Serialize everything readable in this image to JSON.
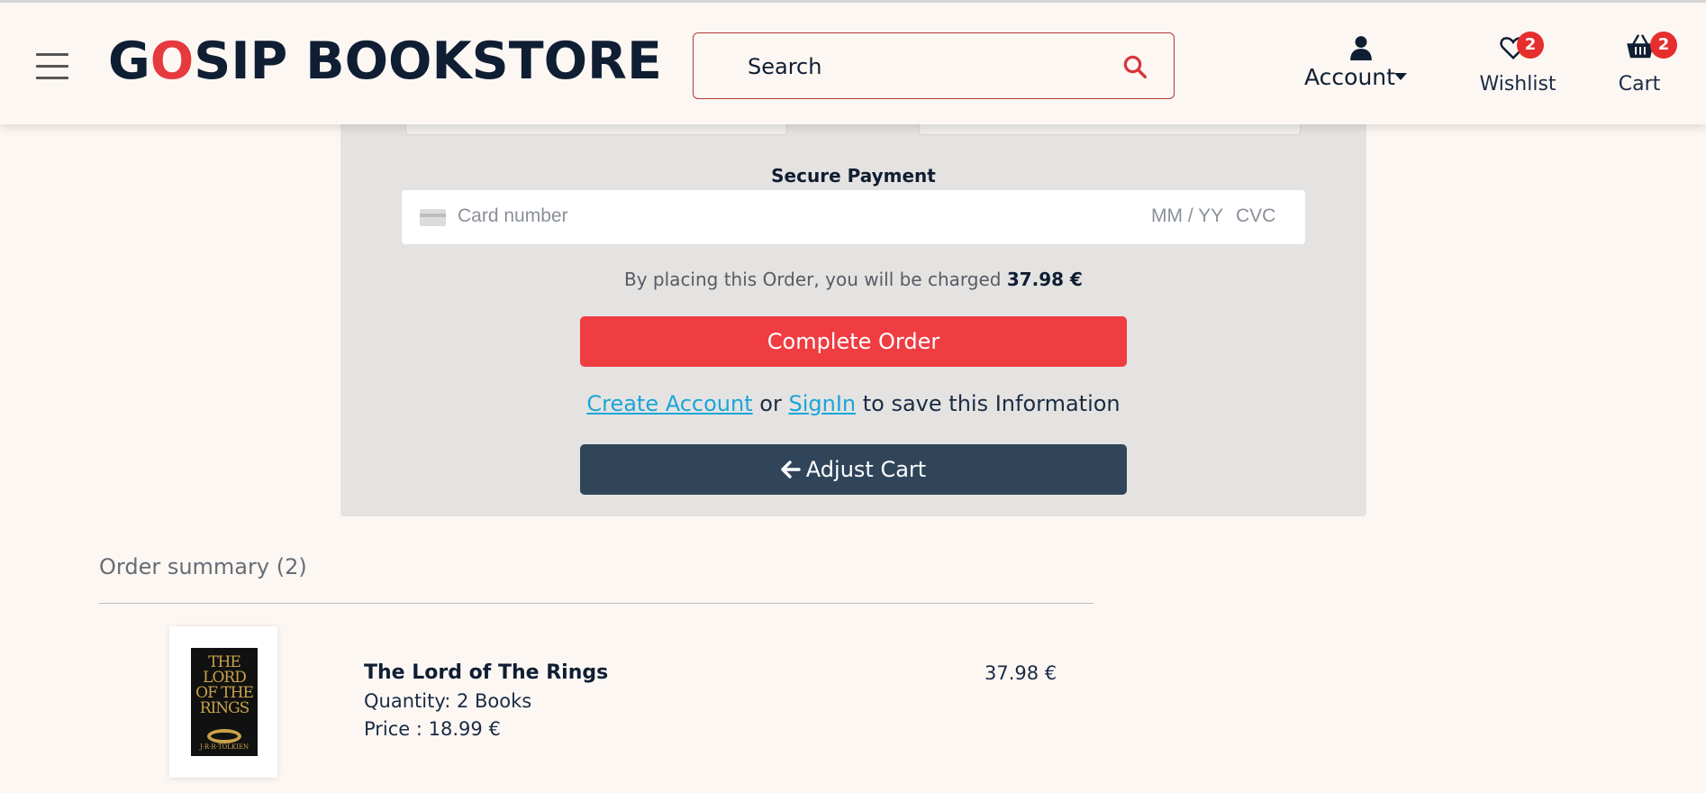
{
  "header": {
    "logo_g": "G",
    "logo_o": "O",
    "logo_rest": "SIP BOOKSTORE",
    "search_placeholder": "Search",
    "account_label": "Account",
    "wishlist_label": "Wishlist",
    "wishlist_count": "2",
    "cart_label": "Cart",
    "cart_count": "2"
  },
  "payment": {
    "section_title": "Secure Payment",
    "card_placeholder": "Card number",
    "expiry_placeholder": "MM / YY",
    "cvc_placeholder": "CVC",
    "charge_text": "By placing this Order, you will be charged",
    "charge_amount": "37.98 €",
    "complete_button": "Complete Order",
    "create_account_link": "Create Account",
    "or_text": "or",
    "signin_link": "SignIn",
    "save_text": "to save this Information",
    "adjust_button": "Adjust Cart"
  },
  "summary": {
    "title": "Order summary (2)",
    "items": [
      {
        "name": "The Lord of The Rings",
        "quantity": "Quantity: 2 Books",
        "price": "Price : 18.99 €",
        "total": "37.98 €",
        "cover_title": "THE LORD OF THE RINGS",
        "cover_author": "J·R·R·TOLKIEN"
      }
    ]
  },
  "colors": {
    "brand_red": "#ef3d42",
    "dark_navy": "#30455a",
    "link_blue": "#1aa6d9",
    "background": "#fdf7f3",
    "panel": "#e5e3e1"
  },
  "icons": {
    "menu": "hamburger-icon",
    "search": "search-icon",
    "account": "user-icon",
    "wishlist": "heart-icon",
    "cart": "basket-icon",
    "card": "credit-card-icon",
    "back": "arrow-left-icon"
  }
}
